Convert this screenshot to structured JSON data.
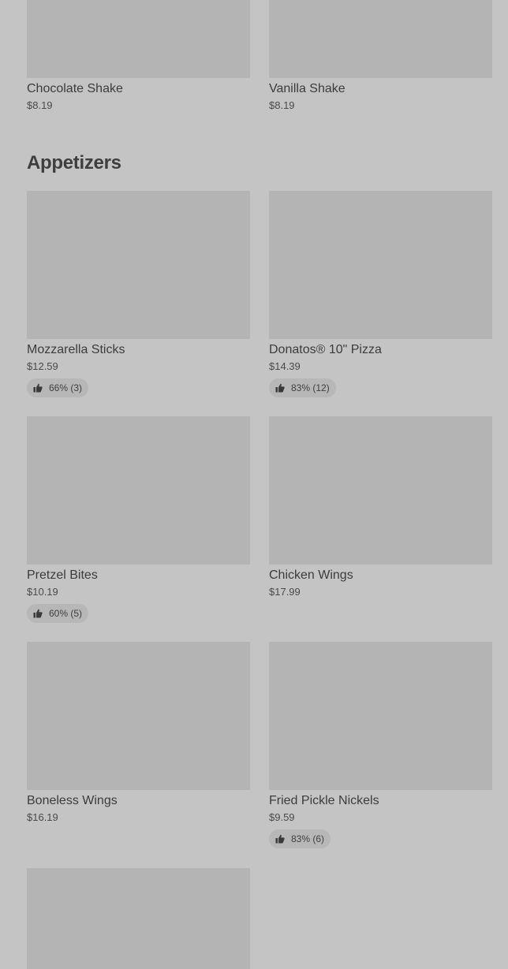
{
  "top_items": [
    {
      "name": "Chocolate Shake",
      "price": "$8.19"
    },
    {
      "name": "Vanilla Shake",
      "price": "$8.19"
    }
  ],
  "appetizers": {
    "title": "Appetizers",
    "items": [
      {
        "name": "Mozzarella Sticks",
        "price": "$12.59",
        "rating": "66% (3)"
      },
      {
        "name": "Donatos® 10\" Pizza",
        "price": "$14.39",
        "rating": "83% (12)"
      },
      {
        "name": "Pretzel Bites",
        "price": "$10.19",
        "rating": "60% (5)"
      },
      {
        "name": "Chicken Wings",
        "price": "$17.99"
      },
      {
        "name": "Boneless Wings",
        "price": "$16.19"
      },
      {
        "name": "Fried Pickle Nickels",
        "price": "$9.59",
        "rating": "83% (6)"
      }
    ]
  },
  "icons": {
    "rating": "thumbs-up-icon"
  }
}
